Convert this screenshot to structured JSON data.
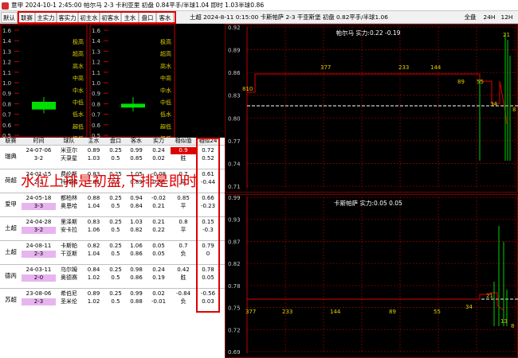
{
  "titlebar": {
    "text": "意甲 2024-10-1 2:45:00 帕尔马 2-3 卡利亚里 初盘 0.84平手/半球1.04 即时 1.03半球0.86"
  },
  "toolbar": {
    "buttons": [
      "默认",
      "联赛",
      "主实力",
      "客实力",
      "初主水",
      "初客水",
      "主水",
      "盘口",
      "客水"
    ],
    "info": "土超 2024-8-11 0:15:00 卡斯帕萨 2-3 干亚斯堡 初盘 0.82平手/半球1.06",
    "right_buttons": [
      "全盘",
      "24H",
      "12H"
    ]
  },
  "gauges": {
    "axis": [
      "1.6",
      "1.4",
      "1.3",
      "1.2",
      "1.1",
      "1.0",
      "0.9",
      "0.8",
      "0.7",
      "0.6",
      "0.5"
    ],
    "levels": [
      "极高",
      "超高",
      "高水",
      "中高",
      "中水",
      "中低",
      "低水",
      "超低",
      "极低"
    ],
    "left_box": {
      "low": 0.77,
      "high": 0.85,
      "whisker_low": 0.73,
      "whisker_high": 0.9
    },
    "right_box": {
      "low": 0.79,
      "high": 0.83,
      "whisker_low": 0.75,
      "whisker_high": 0.9
    }
  },
  "table": {
    "headers": [
      "联赛",
      "时间",
      "球队",
      "主水",
      "盘口",
      "客水",
      "实力",
      "相似值",
      "相似24"
    ],
    "rows": [
      {
        "league": "瑞典",
        "date": "24-07-06",
        "score": "3-2",
        "home": "米亚尔",
        "away": "天录星",
        "mw": [
          "0.89",
          "1.03"
        ],
        "pk": [
          "0.25",
          "0.5"
        ],
        "kw": [
          "0.99",
          "0.85"
        ],
        "sl": [
          "0.24",
          "0.02"
        ],
        "sim": [
          "0.9",
          "胜"
        ],
        "s24": [
          "0.72",
          "0.52"
        ],
        "date_hl": false,
        "sim_hl": true
      },
      {
        "league": "荷超",
        "date": "24-01-15",
        "score": "2-2",
        "home": "费伦斯",
        "away": "托特纳",
        "mw": [
          "0.83",
          "1.01"
        ],
        "pk": [
          "0.25",
          "0.5"
        ],
        "kw": [
          "1.05",
          "0.89"
        ],
        "sl": [
          "-0.08",
          "0.36"
        ],
        "sim": [
          "0.7",
          "平"
        ],
        "s24": [
          "0.61",
          "-0.44"
        ],
        "date_hl": false,
        "sim_hl": false
      },
      {
        "league": "爱甲",
        "date": "24-05-18",
        "score": "3-3",
        "home": "都柏林",
        "away": "奥恩哈",
        "mw": [
          "0.88",
          "1.04"
        ],
        "pk": [
          "0.25",
          "0.5"
        ],
        "kw": [
          "0.94",
          "0.84"
        ],
        "sl": [
          "-0.02",
          "0.21"
        ],
        "sim": [
          "0.85",
          "平"
        ],
        "s24": [
          "0.66",
          "-0.23"
        ],
        "date_hl": true,
        "sim_hl": false
      },
      {
        "league": "土超",
        "date": "24-04-28",
        "score": "3-2",
        "home": "里泽斯",
        "away": "安卡拉",
        "mw": [
          "0.83",
          "1.06"
        ],
        "pk": [
          "0.25",
          "0.5"
        ],
        "kw": [
          "1.03",
          "0.82"
        ],
        "sl": [
          "0.21",
          "0.22"
        ],
        "sim": [
          "0.8",
          "平"
        ],
        "s24": [
          "0.15",
          "-0.3"
        ],
        "date_hl": true,
        "sim_hl": false
      },
      {
        "league": "土超",
        "date": "24-08-11",
        "score": "2-3",
        "home": "卡斯帕",
        "away": "干亚斯",
        "mw": [
          "0.82",
          "1.04"
        ],
        "pk": [
          "0.25",
          "0.5"
        ],
        "kw": [
          "1.06",
          "0.86"
        ],
        "sl": [
          "0.05",
          "0.05"
        ],
        "sim": [
          "0.7",
          "负"
        ],
        "s24": [
          "0.79",
          "0"
        ],
        "date_hl": true,
        "sim_hl": false
      },
      {
        "league": "德丙",
        "date": "24-03-11",
        "score": "2-0",
        "home": "乌尔姆",
        "away": "奥德赛",
        "mw": [
          "0.84",
          "1.02"
        ],
        "pk": [
          "0.25",
          "0.5"
        ],
        "kw": [
          "0.98",
          "0.86"
        ],
        "sl": [
          "0.24",
          "0.19"
        ],
        "sim": [
          "0.42",
          "胜"
        ],
        "s24": [
          "0.78",
          "0.05"
        ],
        "date_hl": true,
        "sim_hl": false
      },
      {
        "league": "苏超",
        "date": "23-08-06",
        "score": "2-3",
        "home": "希伯尼",
        "away": "圣米伦",
        "mw": [
          "0.89",
          "1.02"
        ],
        "pk": [
          "0.25",
          "0.5"
        ],
        "kw": [
          "0.99",
          "0.88"
        ],
        "sl": [
          "0.02",
          "-0.01"
        ],
        "sim": [
          "-0.84",
          "负"
        ],
        "s24": [
          "-0.56",
          "0.03"
        ],
        "date_hl": true,
        "sim_hl": false
      }
    ]
  },
  "note": "水位上排是初盘,下排是即时",
  "charts": [
    {
      "title": "帕尔马 实力:0.22 -0.19",
      "y_ticks": [
        "0.92",
        "0.89",
        "0.86",
        "0.83",
        "0.80",
        "0.77",
        "0.74",
        "0.71"
      ],
      "labels": [
        "810",
        "377",
        "233",
        "144",
        "89",
        "55",
        "34",
        "21",
        "8"
      ]
    },
    {
      "title": "卡斯帕萨 实力:0.05 0.05",
      "y_ticks": [
        "0.99",
        "0.93",
        "0.87",
        "0.82",
        "0.78",
        "0.75",
        "0.72",
        "0.69"
      ],
      "labels": [
        "377",
        "233",
        "144",
        "89",
        "55",
        "34",
        "21",
        "13",
        "8"
      ]
    }
  ],
  "colors": {
    "accent_red": "#e00000",
    "box_green": "#00e000",
    "line_red": "#e00000"
  }
}
